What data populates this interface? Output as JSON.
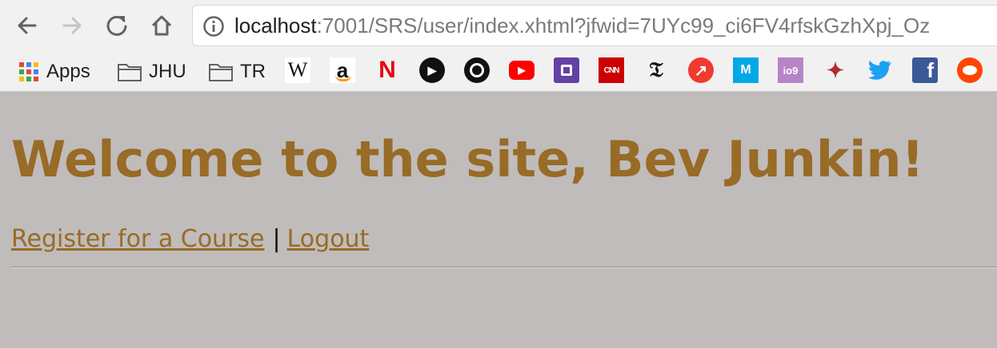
{
  "browser": {
    "url_host": "localhost",
    "url_rest": ":7001/SRS/user/index.xhtml?jfwid=7UYc99_ci6FV4rfskGzhXpj_Oz",
    "bookmarks": {
      "apps_label": "Apps",
      "folders": [
        "JHU",
        "TR"
      ],
      "sites": [
        {
          "icon": "wikipedia-icon",
          "glyph": "W"
        },
        {
          "icon": "amazon-icon",
          "glyph": "a"
        },
        {
          "icon": "netflix-icon",
          "glyph": "N"
        },
        {
          "icon": "play-circle-icon",
          "glyph": "▶"
        },
        {
          "icon": "ring-circle-icon",
          "glyph": ""
        },
        {
          "icon": "youtube-icon",
          "glyph": "▶"
        },
        {
          "icon": "twitch-icon",
          "glyph": ""
        },
        {
          "icon": "cnn-icon",
          "glyph": "CNN"
        },
        {
          "icon": "nytimes-icon",
          "glyph": "𝔗"
        },
        {
          "icon": "trending-arrow-icon",
          "glyph": "↗"
        },
        {
          "icon": "medium-m-icon",
          "glyph": "M"
        },
        {
          "icon": "io9-icon",
          "glyph": "io9"
        },
        {
          "icon": "pixel-creature-icon",
          "glyph": "✦"
        },
        {
          "icon": "twitter-icon",
          "glyph": "🐦"
        },
        {
          "icon": "facebook-icon",
          "glyph": "f"
        },
        {
          "icon": "reddit-icon",
          "glyph": "●"
        }
      ]
    }
  },
  "page": {
    "title": "Welcome to the site, Bev Junkin!",
    "register_link": "Register for a Course",
    "separator": "|",
    "logout_link": "Logout"
  },
  "colors": {
    "page_background": "#c0bcbb",
    "heading_and_links": "#986b26"
  }
}
